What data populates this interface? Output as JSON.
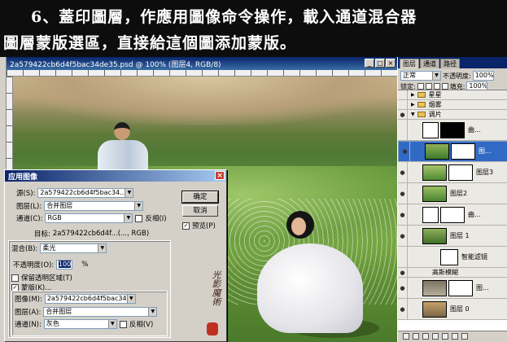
{
  "caption": {
    "line1": "6、蓋印圖層，作應用圖像命令操作，載入通道混合器",
    "line2": "圖層蒙版選區，直接給這個圖添加蒙版。"
  },
  "document": {
    "title": "2a579422cb6d4f5bac34de35.psd @ 100% (图层4, RGB/8)",
    "min": "_",
    "max": "□",
    "close": "×"
  },
  "dialog": {
    "title": "应用图像",
    "source_label": "源(S):",
    "source_value": "2a579422cb6d4f5bac34...",
    "layer_label": "图层(L):",
    "layer_value": "合并图层",
    "channel_label": "通道(C):",
    "channel_value": "RGB",
    "invert_label": "反相(I)",
    "target_label": "目标:",
    "target_value": "2a579422cb6d4f...(..., RGB)",
    "blending_label": "混合(B):",
    "blending_value": "柔光",
    "opacity_label": "不透明度(O):",
    "opacity_value": "100",
    "opacity_unit": "%",
    "preserve_label": "保留透明区域(T)",
    "mask_label": "蒙版(K)...",
    "mask_image_label": "图像(M):",
    "mask_image_value": "2a579422cb6d4f5bac34...",
    "mask_layer_label": "图层(A):",
    "mask_layer_value": "合并图层",
    "mask_channel_label": "通道(N):",
    "mask_channel_value": "灰色",
    "mask_invert_label": "反相(V)",
    "ok": "确定",
    "cancel": "取消",
    "preview_label": "预览(P)"
  },
  "stamp_text": "光影魔术手",
  "panel": {
    "tabs": [
      "图层",
      "通道",
      "路径"
    ],
    "blend_mode": "正常",
    "opacity_label": "不透明度:",
    "opacity_value": "100%",
    "lock_label": "锁定:",
    "fill_label": "填充:",
    "fill_value": "100%",
    "layers": [
      {
        "name": "星星",
        "kind": "group"
      },
      {
        "name": "烟雾",
        "kind": "group"
      },
      {
        "name": "调片",
        "kind": "group-open"
      },
      {
        "name": "曲...",
        "kind": "adj"
      },
      {
        "name": "图...",
        "kind": "selected"
      },
      {
        "name": "图层3",
        "kind": "photo"
      },
      {
        "name": "图层2",
        "kind": "photo"
      },
      {
        "name": "曲...",
        "kind": "adj"
      },
      {
        "name": "图层 1",
        "kind": "smart"
      },
      {
        "name": "智能滤镜",
        "kind": "filter"
      },
      {
        "name": "高斯模糊",
        "kind": "filter-item"
      },
      {
        "name": "图...",
        "kind": "mask"
      },
      {
        "name": "图层 0",
        "kind": "photo"
      }
    ]
  },
  "colors": {
    "title_bar": "#0a246a",
    "selected_layer": "#316ac5",
    "dialog_bg": "#d4d0c8"
  }
}
